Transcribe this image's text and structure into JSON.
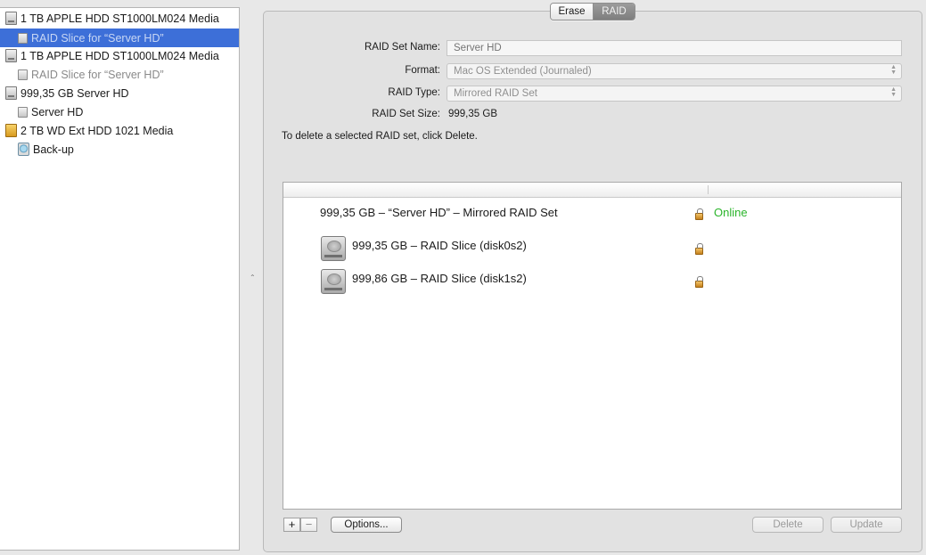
{
  "sidebar": {
    "items": [
      {
        "label": "1 TB APPLE HDD ST1000LM024 Media",
        "icon": "hard-disk-icon"
      },
      {
        "label": "RAID Slice for “Server HD”",
        "icon": "volume-icon",
        "selected": true
      },
      {
        "label": "1 TB APPLE HDD ST1000LM024 Media",
        "icon": "hard-disk-icon"
      },
      {
        "label": "RAID Slice for “Server HD”",
        "icon": "volume-icon"
      },
      {
        "label": "999,35 GB Server HD",
        "icon": "raid-set-icon"
      },
      {
        "label": "Server HD",
        "icon": "volume-icon"
      },
      {
        "label": "2 TB WD Ext HDD 1021 Media",
        "icon": "external-disk-icon"
      },
      {
        "label": "Back-up",
        "icon": "time-machine-volume-icon"
      }
    ]
  },
  "tabs": {
    "erase": "Erase",
    "raid": "RAID",
    "active": "RAID"
  },
  "form": {
    "raid_set_name_label": "RAID Set Name:",
    "raid_set_name_placeholder": "Server HD",
    "format_label": "Format:",
    "format_value": "Mac OS Extended (Journaled)",
    "raid_type_label": "RAID Type:",
    "raid_type_value": "Mirrored RAID Set",
    "raid_set_size_label": "RAID Set Size:",
    "raid_set_size_value": "999,35 GB",
    "instruction": "To delete a selected RAID set, click Delete."
  },
  "raid_table": {
    "rows": [
      {
        "name": "999,35 GB – “Server HD” – Mirrored RAID Set",
        "status": "Online",
        "locked": true
      },
      {
        "name": "999,35 GB – RAID Slice (disk0s2)",
        "status": "",
        "locked": true
      },
      {
        "name": "999,86 GB – RAID Slice (disk1s2)",
        "status": "",
        "locked": true
      }
    ]
  },
  "buttons": {
    "add": "+",
    "remove": "−",
    "options": "Options...",
    "delete": "Delete",
    "update": "Update"
  },
  "colors": {
    "selection": "#3d6fd8",
    "online_status": "#2bb52b"
  }
}
